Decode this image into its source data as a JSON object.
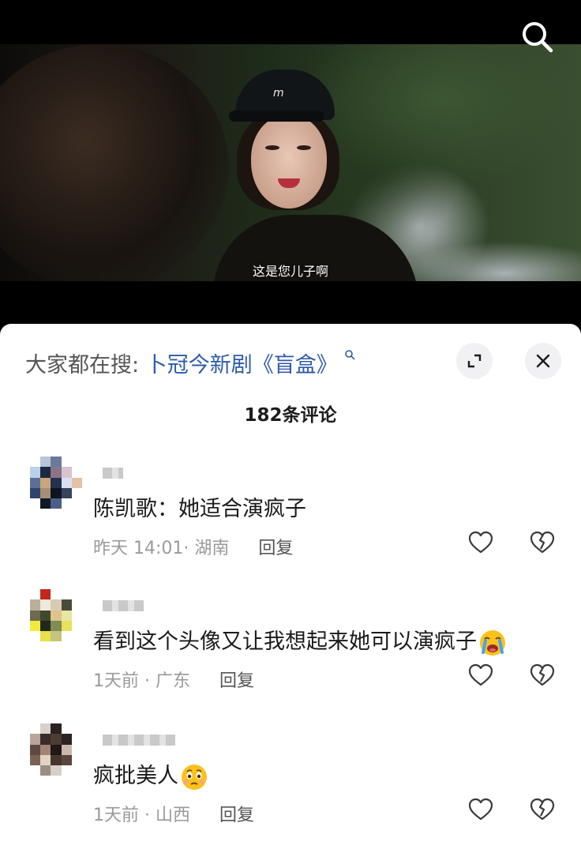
{
  "video": {
    "subtitle": "这是您儿子啊",
    "cap_logo": "m"
  },
  "sheet": {
    "search_prefix": "大家都在搜:",
    "search_link": "卜冠今新剧《盲盒》",
    "comment_count": "182条评论"
  },
  "comments": [
    {
      "text": "陈凯歌：她适合演疯子",
      "time": "昨天 14:01",
      "location": "湖南",
      "reply_label": "回复"
    },
    {
      "text": "看到这个头像又让我想起来她可以演疯子",
      "emoji": "loudly-crying-face",
      "time": "1天前",
      "location": "广东",
      "reply_label": "回复"
    },
    {
      "text": "疯批美人",
      "emoji": "face-holding-back-tears",
      "time": "1天前",
      "location": "山西",
      "reply_label": "回复"
    }
  ],
  "colors": {
    "link": "#2d5ba8",
    "meta_gray": "#9a9a9a",
    "sheet_bg": "#ffffff",
    "circle_btn_bg": "#f1f1f3"
  },
  "icons": [
    "search-icon",
    "expand-icon",
    "close-icon",
    "heart-icon",
    "broken-heart-icon"
  ]
}
